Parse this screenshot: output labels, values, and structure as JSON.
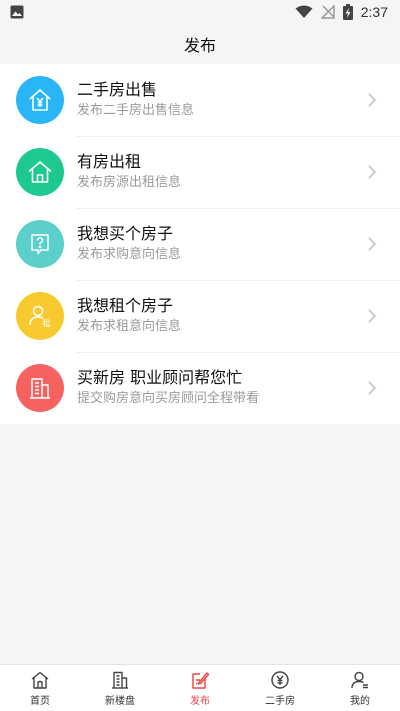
{
  "status_bar": {
    "time": "2:37"
  },
  "header": {
    "title": "发布"
  },
  "items": [
    {
      "title": "二手房出售",
      "subtitle": "发布二手房出售信息",
      "color": "#29b6f6",
      "icon": "house-yen-icon"
    },
    {
      "title": "有房出租",
      "subtitle": "发布房源出租信息",
      "color": "#1ec98d",
      "icon": "house-icon"
    },
    {
      "title": "我想买个房子",
      "subtitle": "发布求购意向信息",
      "color": "#5bcfc9",
      "icon": "question-bubble-icon"
    },
    {
      "title": "我想租个房子",
      "subtitle": "发布求租意向信息",
      "color": "#f9c930",
      "icon": "person-rent-icon"
    },
    {
      "title": "买新房 职业顾问帮您忙",
      "subtitle": "提交购房意向买房顾问全程带看",
      "color": "#f6625f",
      "icon": "building-icon"
    }
  ],
  "rent_badge": "租",
  "tabs": [
    {
      "label": "首页",
      "icon": "home-icon"
    },
    {
      "label": "新楼盘",
      "icon": "building-icon"
    },
    {
      "label": "发布",
      "icon": "publish-icon",
      "active": true
    },
    {
      "label": "二手房",
      "icon": "yen-circle-icon"
    },
    {
      "label": "我的",
      "icon": "user-icon"
    }
  ],
  "accent_color": "#e8433e"
}
